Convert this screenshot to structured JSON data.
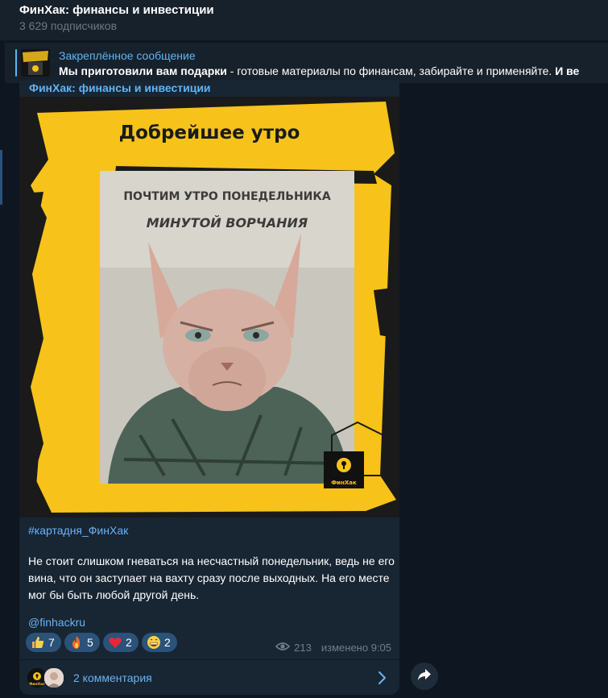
{
  "header": {
    "title": "ФинХак: финансы и инвестиции",
    "subscribers": "3 629 подписчиков"
  },
  "pinned": {
    "title": "Закреплённое сообщение",
    "text_bold": "Мы приготовили вам подарки",
    "text_rest": " - готовые материалы по финансам, забирайте и применяйте. ",
    "text_tail": "И ве"
  },
  "message": {
    "channel": "ФинХак: финансы и инвестиции",
    "image": {
      "quote_mark": "“",
      "headline": "Добрейшее утро",
      "line1": "ПОЧТИМ УТРО ПОНЕДЕЛЬНИКА",
      "line2": "МИНУТОЙ ВОРЧАНИЯ",
      "logo_text": "ФинХак"
    },
    "hashtag": "#картадня_ФинХак",
    "text": "Не стоит слишком гневаться на несчастный понедельник, ведь не его вина, что он заступает на вахту сразу после выходных. На его месте мог бы быть любой другой день.",
    "handle": "@finhackru",
    "reactions": [
      {
        "icon": "thumbs-up-icon",
        "count": "7"
      },
      {
        "icon": "fire-icon",
        "count": "5"
      },
      {
        "icon": "heart-icon",
        "count": "2"
      },
      {
        "icon": "grin-icon",
        "count": "2"
      }
    ],
    "views": "213",
    "edited": "изменено 9:05",
    "comments_label": "2 комментария",
    "avatar_logo_text": "ФинХак"
  },
  "colors": {
    "background": "#0e1621",
    "panel": "#17212b",
    "bubble": "#182533",
    "accent": "#5eb5f7",
    "brand_yellow": "#f7c21a"
  }
}
